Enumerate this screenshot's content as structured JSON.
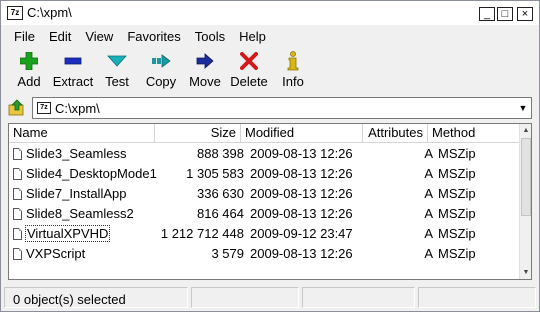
{
  "window": {
    "title": "C:\\xpm\\",
    "icon_text": "7z"
  },
  "title_buttons": {
    "minimize": "_",
    "maximize": "□",
    "close": "×"
  },
  "menu": [
    "File",
    "Edit",
    "View",
    "Favorites",
    "Tools",
    "Help"
  ],
  "toolbar": [
    {
      "label": "Add",
      "icon": "plus-icon",
      "color": "#19a31c"
    },
    {
      "label": "Extract",
      "icon": "minus-icon",
      "color": "#1a2fbf"
    },
    {
      "label": "Test",
      "icon": "check-down-icon",
      "color": "#1ab0b8"
    },
    {
      "label": "Copy",
      "icon": "copy-arrow-icon",
      "color": "#1a9aa0"
    },
    {
      "label": "Move",
      "icon": "move-arrow-icon",
      "color": "#1b2d9a"
    },
    {
      "label": "Delete",
      "icon": "delete-x-icon",
      "color": "#d11a1a"
    },
    {
      "label": "Info",
      "icon": "info-icon",
      "color": "#d8b814"
    }
  ],
  "address": {
    "path": "C:\\xpm\\",
    "icon_text": "7z"
  },
  "columns": [
    "Name",
    "Size",
    "Modified",
    "Attributes",
    "Method"
  ],
  "files": [
    {
      "name": "Slide3_Seamless",
      "size": "888 398",
      "modified": "2009-08-13 12:26",
      "attributes": "A",
      "method": "MSZip"
    },
    {
      "name": "Slide4_DesktopMode1",
      "size": "1 305 583",
      "modified": "2009-08-13 12:26",
      "attributes": "A",
      "method": "MSZip"
    },
    {
      "name": "Slide7_InstallApp",
      "size": "336 630",
      "modified": "2009-08-13 12:26",
      "attributes": "A",
      "method": "MSZip"
    },
    {
      "name": "Slide8_Seamless2",
      "size": "816 464",
      "modified": "2009-08-13 12:26",
      "attributes": "A",
      "method": "MSZip"
    },
    {
      "name": "VirtualXPVHD",
      "size": "1 212 712 448",
      "modified": "2009-09-12 23:47",
      "attributes": "A",
      "method": "MSZip"
    },
    {
      "name": "VXPScript",
      "size": "3 579",
      "modified": "2009-08-13 12:26",
      "attributes": "A",
      "method": "MSZip"
    }
  ],
  "status": {
    "text": "0 object(s) selected"
  }
}
